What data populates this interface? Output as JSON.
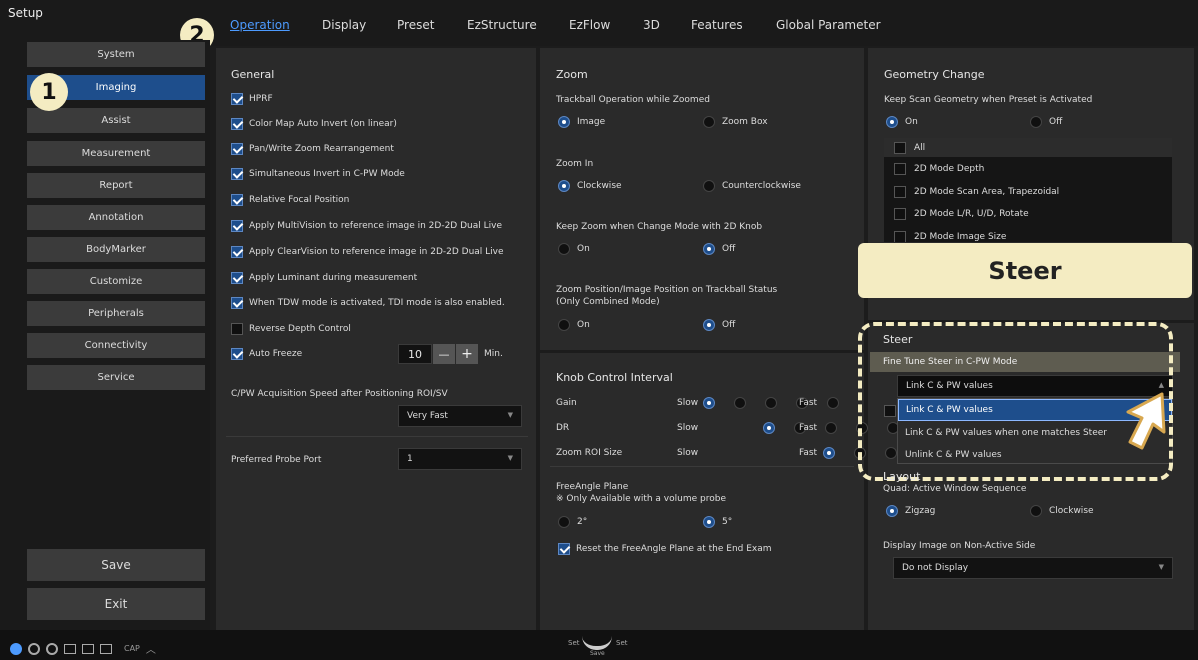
{
  "app_title": "Setup",
  "tabs": [
    "Operation",
    "Display",
    "Preset",
    "EzStructure",
    "EzFlow",
    "3D",
    "Features",
    "Global Parameter"
  ],
  "sidebar": {
    "items": [
      "System",
      "Imaging",
      "Assist",
      "Measurement",
      "Report",
      "Annotation",
      "BodyMarker",
      "Customize",
      "Peripherals",
      "Connectivity",
      "Service"
    ],
    "active": "Imaging",
    "save_label": "Save",
    "exit_label": "Exit"
  },
  "callouts": {
    "one": "1",
    "two": "2"
  },
  "general": {
    "title": "General",
    "checkboxes": [
      {
        "label": "HPRF",
        "checked": true
      },
      {
        "label": "Color Map Auto Invert (on linear)",
        "checked": true
      },
      {
        "label": "Pan/Write Zoom Rearrangement",
        "checked": true
      },
      {
        "label": "Simultaneous Invert in C-PW Mode",
        "checked": true
      },
      {
        "label": "Relative Focal Position",
        "checked": true
      },
      {
        "label": "Apply MultiVision to reference image in 2D-2D Dual Live",
        "checked": true
      },
      {
        "label": "Apply ClearVision to reference image in 2D-2D Dual Live",
        "checked": true
      },
      {
        "label": "Apply Luminant during measurement",
        "checked": true
      },
      {
        "label": "When TDW mode is activated, TDI mode is also enabled.",
        "checked": true
      },
      {
        "label": "Reverse Depth Control",
        "checked": false
      },
      {
        "label": "Auto Freeze",
        "checked": true
      }
    ],
    "auto_freeze_value": "10",
    "auto_freeze_unit": "Min.",
    "minus": "—",
    "plus": "+",
    "acq_speed_label": "C/PW Acquisition Speed after Positioning ROI/SV",
    "acq_speed_value": "Very Fast",
    "probe_port_label": "Preferred Probe Port",
    "probe_port_value": "1"
  },
  "zoom": {
    "title": "Zoom",
    "trackball_label": "Trackball Operation while Zoomed",
    "trackball_opts": [
      "Image",
      "Zoom Box"
    ],
    "zoom_in_label": "Zoom In",
    "zoom_in_opts": [
      "Clockwise",
      "Counterclockwise"
    ],
    "keep_zoom_label": "Keep Zoom when Change Mode with 2D Knob",
    "keep_zoom_opts": [
      "On",
      "Off"
    ],
    "zoom_pos_label": "Zoom Position/Image Position on Trackball Status",
    "zoom_pos_sub": "(Only Combined Mode)",
    "zoom_pos_opts": [
      "On",
      "Off"
    ]
  },
  "knob": {
    "title": "Knob Control Interval",
    "rows": [
      {
        "label": "Gain",
        "slow": "Slow",
        "fast": "Fast",
        "level": 1
      },
      {
        "label": "DR",
        "slow": "Slow",
        "fast": "Fast",
        "level": 1
      },
      {
        "label": "Zoom ROI Size",
        "slow": "Slow",
        "fast": "Fast",
        "level": 1
      }
    ],
    "freeangle_label": "FreeAngle Plane",
    "freeangle_note": "※ Only Available with a volume probe",
    "freeangle_opts": [
      "2°",
      "5°"
    ],
    "reset_label": "Reset the FreeAngle Plane at the End Exam"
  },
  "geometry": {
    "title": "Geometry Change",
    "keep_label": "Keep Scan Geometry when Preset is Activated",
    "keep_opts": [
      "On",
      "Off"
    ],
    "list": [
      "All",
      "2D Mode Depth",
      "2D Mode Scan Area, Trapezoidal",
      "2D Mode L/R, U/D, Rotate",
      "2D Mode Image Size"
    ]
  },
  "steer_banner": "Steer",
  "steer": {
    "title": "Steer",
    "fine_tune_label": "Fine Tune Steer in C-PW Mode",
    "selected": "Link C & PW values",
    "options": [
      "Link C & PW values",
      "Link C & PW values when one matches Steer",
      "Unlink C & PW values"
    ]
  },
  "layout": {
    "title": "Layout",
    "quad_label": "Quad: Active Window Sequence",
    "quad_opts": [
      "Zigzag",
      "Clockwise"
    ],
    "display_label": "Display Image on Non-Active Side",
    "display_value": "Do not Display"
  },
  "statusbar": {
    "cap": "CAP",
    "set_left": "Set",
    "set_right": "Set",
    "save": "Save"
  },
  "colors": {
    "accent": "#4d9bff",
    "active_bg": "#1e4e8c",
    "callout": "#f4ecc2"
  }
}
